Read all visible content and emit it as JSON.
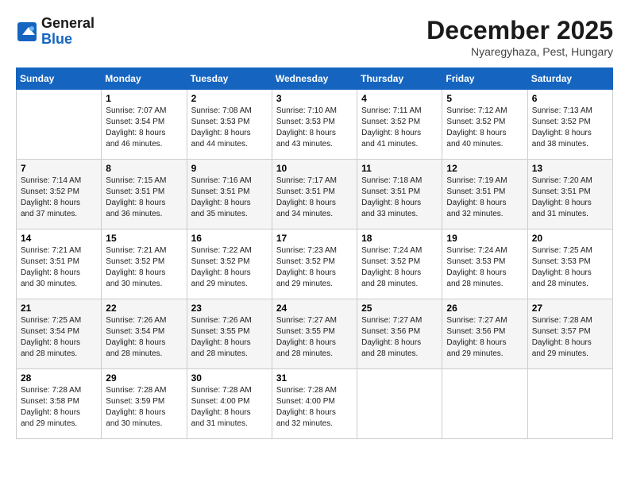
{
  "header": {
    "logo_line1": "General",
    "logo_line2": "Blue",
    "month": "December 2025",
    "location": "Nyaregyhaza, Pest, Hungary"
  },
  "weekdays": [
    "Sunday",
    "Monday",
    "Tuesday",
    "Wednesday",
    "Thursday",
    "Friday",
    "Saturday"
  ],
  "weeks": [
    [
      {
        "day": "",
        "info": ""
      },
      {
        "day": "1",
        "info": "Sunrise: 7:07 AM\nSunset: 3:54 PM\nDaylight: 8 hours\nand 46 minutes."
      },
      {
        "day": "2",
        "info": "Sunrise: 7:08 AM\nSunset: 3:53 PM\nDaylight: 8 hours\nand 44 minutes."
      },
      {
        "day": "3",
        "info": "Sunrise: 7:10 AM\nSunset: 3:53 PM\nDaylight: 8 hours\nand 43 minutes."
      },
      {
        "day": "4",
        "info": "Sunrise: 7:11 AM\nSunset: 3:52 PM\nDaylight: 8 hours\nand 41 minutes."
      },
      {
        "day": "5",
        "info": "Sunrise: 7:12 AM\nSunset: 3:52 PM\nDaylight: 8 hours\nand 40 minutes."
      },
      {
        "day": "6",
        "info": "Sunrise: 7:13 AM\nSunset: 3:52 PM\nDaylight: 8 hours\nand 38 minutes."
      }
    ],
    [
      {
        "day": "7",
        "info": "Sunrise: 7:14 AM\nSunset: 3:52 PM\nDaylight: 8 hours\nand 37 minutes."
      },
      {
        "day": "8",
        "info": "Sunrise: 7:15 AM\nSunset: 3:51 PM\nDaylight: 8 hours\nand 36 minutes."
      },
      {
        "day": "9",
        "info": "Sunrise: 7:16 AM\nSunset: 3:51 PM\nDaylight: 8 hours\nand 35 minutes."
      },
      {
        "day": "10",
        "info": "Sunrise: 7:17 AM\nSunset: 3:51 PM\nDaylight: 8 hours\nand 34 minutes."
      },
      {
        "day": "11",
        "info": "Sunrise: 7:18 AM\nSunset: 3:51 PM\nDaylight: 8 hours\nand 33 minutes."
      },
      {
        "day": "12",
        "info": "Sunrise: 7:19 AM\nSunset: 3:51 PM\nDaylight: 8 hours\nand 32 minutes."
      },
      {
        "day": "13",
        "info": "Sunrise: 7:20 AM\nSunset: 3:51 PM\nDaylight: 8 hours\nand 31 minutes."
      }
    ],
    [
      {
        "day": "14",
        "info": "Sunrise: 7:21 AM\nSunset: 3:51 PM\nDaylight: 8 hours\nand 30 minutes."
      },
      {
        "day": "15",
        "info": "Sunrise: 7:21 AM\nSunset: 3:52 PM\nDaylight: 8 hours\nand 30 minutes."
      },
      {
        "day": "16",
        "info": "Sunrise: 7:22 AM\nSunset: 3:52 PM\nDaylight: 8 hours\nand 29 minutes."
      },
      {
        "day": "17",
        "info": "Sunrise: 7:23 AM\nSunset: 3:52 PM\nDaylight: 8 hours\nand 29 minutes."
      },
      {
        "day": "18",
        "info": "Sunrise: 7:24 AM\nSunset: 3:52 PM\nDaylight: 8 hours\nand 28 minutes."
      },
      {
        "day": "19",
        "info": "Sunrise: 7:24 AM\nSunset: 3:53 PM\nDaylight: 8 hours\nand 28 minutes."
      },
      {
        "day": "20",
        "info": "Sunrise: 7:25 AM\nSunset: 3:53 PM\nDaylight: 8 hours\nand 28 minutes."
      }
    ],
    [
      {
        "day": "21",
        "info": "Sunrise: 7:25 AM\nSunset: 3:54 PM\nDaylight: 8 hours\nand 28 minutes."
      },
      {
        "day": "22",
        "info": "Sunrise: 7:26 AM\nSunset: 3:54 PM\nDaylight: 8 hours\nand 28 minutes."
      },
      {
        "day": "23",
        "info": "Sunrise: 7:26 AM\nSunset: 3:55 PM\nDaylight: 8 hours\nand 28 minutes."
      },
      {
        "day": "24",
        "info": "Sunrise: 7:27 AM\nSunset: 3:55 PM\nDaylight: 8 hours\nand 28 minutes."
      },
      {
        "day": "25",
        "info": "Sunrise: 7:27 AM\nSunset: 3:56 PM\nDaylight: 8 hours\nand 28 minutes."
      },
      {
        "day": "26",
        "info": "Sunrise: 7:27 AM\nSunset: 3:56 PM\nDaylight: 8 hours\nand 29 minutes."
      },
      {
        "day": "27",
        "info": "Sunrise: 7:28 AM\nSunset: 3:57 PM\nDaylight: 8 hours\nand 29 minutes."
      }
    ],
    [
      {
        "day": "28",
        "info": "Sunrise: 7:28 AM\nSunset: 3:58 PM\nDaylight: 8 hours\nand 29 minutes."
      },
      {
        "day": "29",
        "info": "Sunrise: 7:28 AM\nSunset: 3:59 PM\nDaylight: 8 hours\nand 30 minutes."
      },
      {
        "day": "30",
        "info": "Sunrise: 7:28 AM\nSunset: 4:00 PM\nDaylight: 8 hours\nand 31 minutes."
      },
      {
        "day": "31",
        "info": "Sunrise: 7:28 AM\nSunset: 4:00 PM\nDaylight: 8 hours\nand 32 minutes."
      },
      {
        "day": "",
        "info": ""
      },
      {
        "day": "",
        "info": ""
      },
      {
        "day": "",
        "info": ""
      }
    ]
  ]
}
